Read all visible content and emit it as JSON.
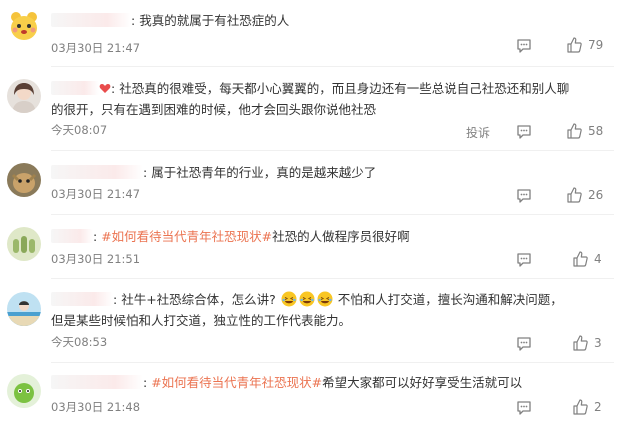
{
  "comments": [
    {
      "text": "我真的就属于有社恐症的人",
      "time": "03月30日 21:47",
      "likes": "79"
    },
    {
      "text": "社恐真的很难受，每天都小心翼翼的，而且身边还有一些总说自己社恐还和别人聊的很开，只有在遇到困难的时候，他才会回头跟你说他社恐",
      "time": "今天08:07",
      "report_label": "投诉",
      "likes": "58"
    },
    {
      "text": "属于社恐青年的行业，真的是越来越少了",
      "time": "03月30日 21:47",
      "likes": "26"
    },
    {
      "hashtag": "#如何看待当代青年社恐现状#",
      "text": "社恐的人做程序员很好啊",
      "time": "03月30日 21:51",
      "likes": "4"
    },
    {
      "text_a": "社牛+社恐综合体，怎么讲?",
      "text_b": "不怕和人打交道，擅长沟通和解决问题，但是某些时候怕和人打交道，独立性的工作代表能力。",
      "time": "今天08:53",
      "likes": "3"
    },
    {
      "hashtag": "#如何看待当代青年社恐现状#",
      "text": "希望大家都可以好好享受生活就可以",
      "time": "03月30日 21:48",
      "likes": "2"
    }
  ],
  "separator": ":",
  "icons": {
    "comment": "comment-icon",
    "like": "thumbs-up-icon",
    "emoji": "laughing-emoji-icon",
    "heart": "heart-emoji-icon"
  },
  "colors": {
    "hashtag": "#eb7350",
    "meta": "#808080",
    "text": "#333333"
  }
}
